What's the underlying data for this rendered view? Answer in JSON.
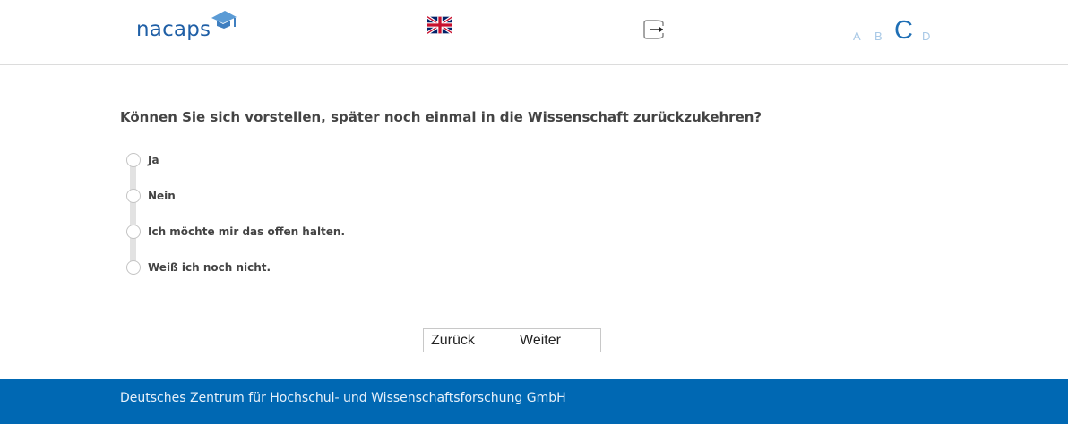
{
  "header": {
    "logo_text": "nacaps",
    "language_flag": "uk-flag-icon",
    "logout_icon": "logout-icon",
    "font_sizes": [
      "A",
      "B",
      "C",
      "D"
    ],
    "font_size_selected": "C"
  },
  "question": {
    "text": "Können Sie sich vorstellen, später noch einmal in die Wissenschaft zurückzukehren?",
    "options": [
      {
        "label": "Ja"
      },
      {
        "label": "Nein"
      },
      {
        "label": "Ich möchte mir das offen halten."
      },
      {
        "label": "Weiß ich noch nicht."
      }
    ]
  },
  "navigation": {
    "back_label": "Zurück",
    "next_label": "Weiter"
  },
  "footer": {
    "text": "Deutsches Zentrum für Hochschul- und Wissenschaftsforschung GmbH"
  },
  "colors": {
    "brand": "#1f5fa6",
    "footer_bg": "#0068b3",
    "font_size_inactive": "#a9c9e6"
  }
}
